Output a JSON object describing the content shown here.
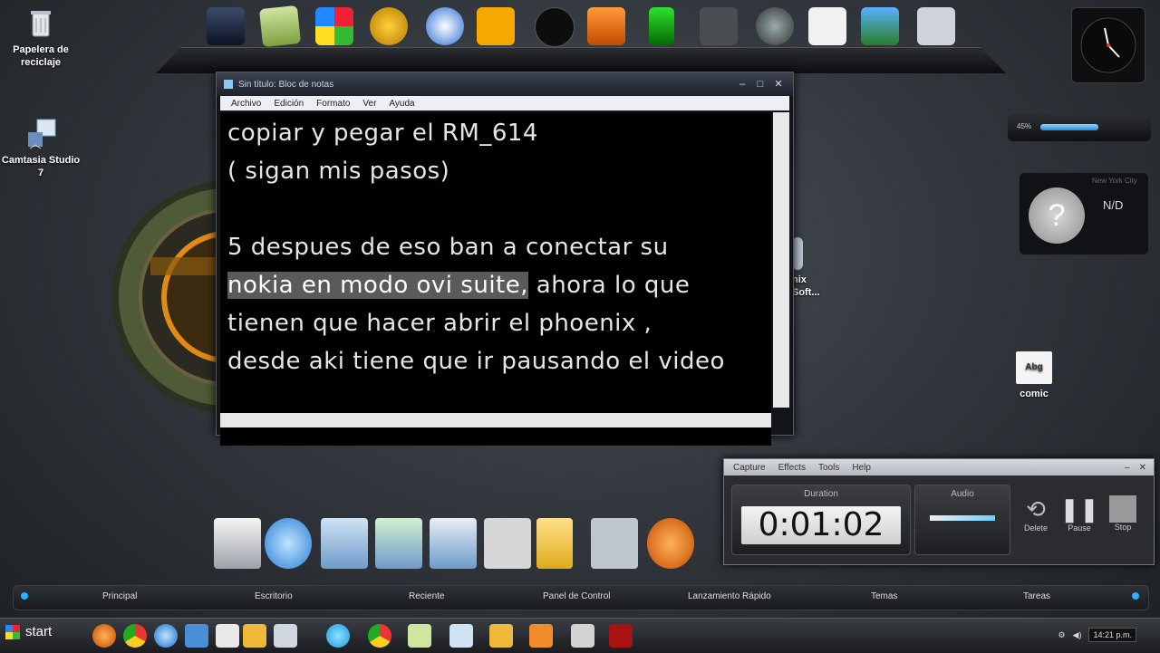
{
  "desktop": {
    "icons": [
      {
        "label": "Papelera de reciclaje",
        "icon": "recycle-bin-icon"
      },
      {
        "label": "Camtasia Studio 7",
        "icon": "camtasia-icon"
      },
      {
        "label": "comic",
        "icon": "text-file-icon",
        "badge": "Abg"
      },
      {
        "label": "nix",
        "icon": "phoenix-icon"
      },
      {
        "label": "Soft...",
        "icon": "phoenix-icon"
      }
    ]
  },
  "notepad": {
    "title": "Sin título: Bloc de notas",
    "menu": [
      "Archivo",
      "Edición",
      "Formato",
      "Ver",
      "Ayuda"
    ],
    "lines": [
      "copiar y pegar el RM_614",
      "( sigan mis pasos)",
      "",
      "5 despues de eso ban a conectar su",
      "ahora lo que",
      "tienen que hacer abrir el phoenix ,",
      "desde aki tiene que ir pausando el video"
    ],
    "highlighted": "nokia en modo ovi suite,"
  },
  "gadgets": {
    "volume_left": "45%",
    "weather_city": "New York City",
    "weather_value": "N/D"
  },
  "recorder": {
    "menu": [
      "Capture",
      "Effects",
      "Tools",
      "Help"
    ],
    "duration_label": "Duration",
    "audio_label": "Audio",
    "timer": "0:01:02",
    "buttons": [
      "Delete",
      "Pause",
      "Stop"
    ]
  },
  "tabbar": {
    "tabs": [
      "Principal",
      "Escritorio",
      "Reciente",
      "Panel de Control",
      "Lanzamiento Rápido",
      "Temas",
      "Tareas"
    ]
  },
  "taskbar": {
    "start_label": "start",
    "time": "14:21 p.m."
  },
  "colors": {
    "accent": "#2ab4ff",
    "notepad_bg": "#000000",
    "highlight": "#5a5a5a"
  }
}
